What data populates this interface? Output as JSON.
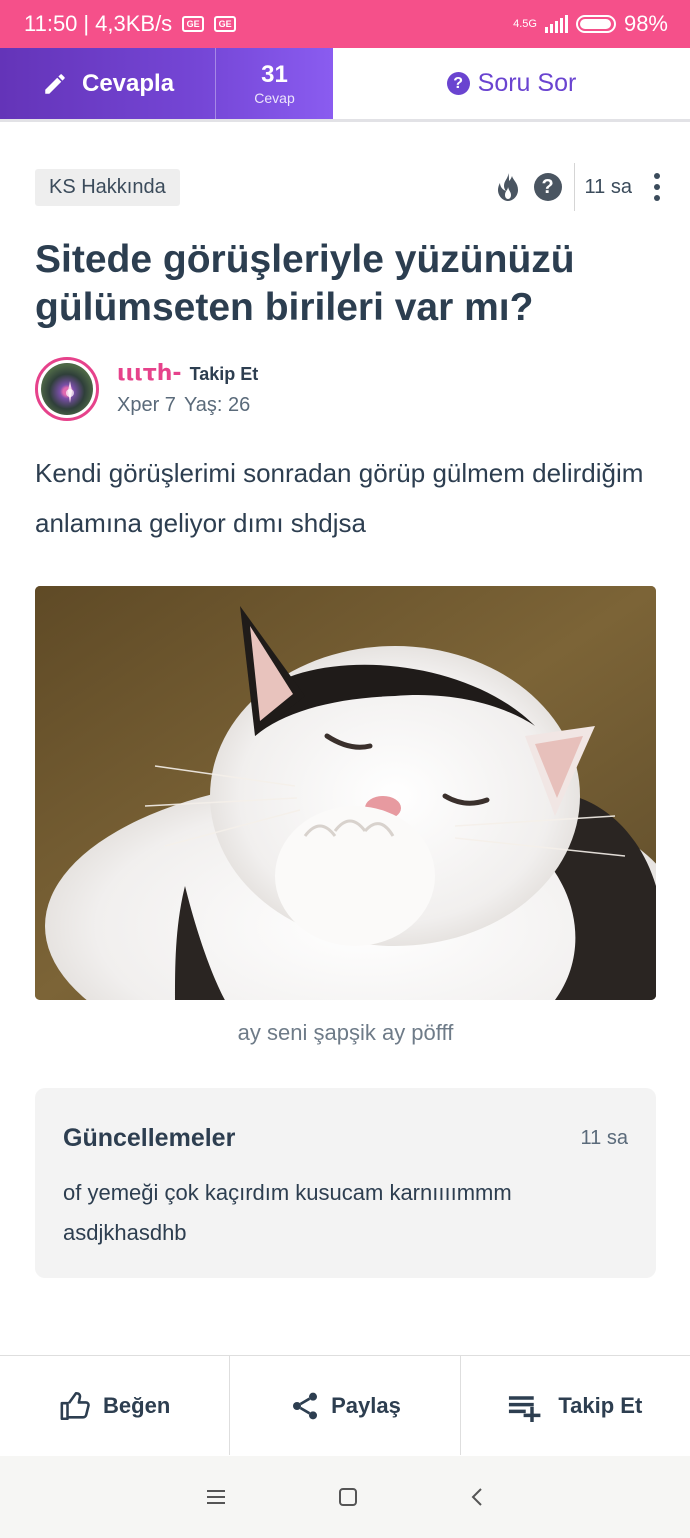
{
  "status_bar": {
    "time": "11:50",
    "speed": "4,3KB/s",
    "badge1": "GE",
    "badge2": "GE",
    "network": "4.5G",
    "battery": "98%",
    "background": "#f5508a"
  },
  "topbar": {
    "answer_label": "Cevapla",
    "answer_count": "31",
    "answer_count_label": "Cevap",
    "ask_label": "Soru Sor",
    "accent": "#6a44d0"
  },
  "post": {
    "category": "KS Hakkında",
    "time": "11 sa",
    "title": "Sitede görüşleriyle yüzünüzü gülümseten birileri var mı?",
    "author": {
      "username": "ιιιτh-",
      "follow_label": "Takip Et",
      "level": "Xper 7",
      "age": "Yaş: 26"
    },
    "body": "Kendi görüşlerimi sonradan görüp gülmem delirdiğim anlamına geliyor dımı shdjsa",
    "image_caption": "ay seni şapşik ay pöfff"
  },
  "updates": {
    "title": "Güncellemeler",
    "time": "11 sa",
    "text": "of yemeği çok kaçırdım kusucam karnıııımmm asdjkhasdhb"
  },
  "bottom_bar": {
    "like_label": "Beğen",
    "share_label": "Paylaş",
    "follow_label": "Takip Et"
  },
  "icons": [
    "pencil-icon",
    "question-circle-icon",
    "flame-icon",
    "help-icon",
    "more-vertical-icon",
    "thumbs-up-icon",
    "share-icon",
    "playlist-add-icon",
    "menu-icon",
    "home-square-icon",
    "back-chevron-icon"
  ]
}
